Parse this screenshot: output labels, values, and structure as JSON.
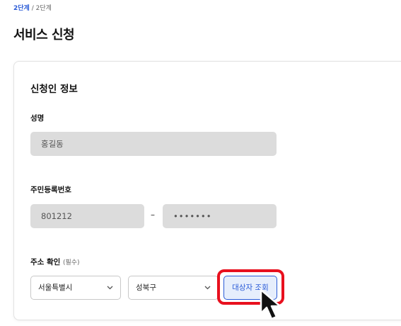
{
  "breadcrumb": {
    "current": "2단계",
    "separator": "/",
    "total": "2단계"
  },
  "page_title": "서비스 신청",
  "section": {
    "title": "신청인 정보",
    "name": {
      "label": "성명",
      "value": "홍길동"
    },
    "resident_number": {
      "label": "주민등록번호",
      "front": "801212",
      "separator": "–",
      "back": "•••••••"
    },
    "address": {
      "label": "주소 확인",
      "hint": "(필수)",
      "city": "서울특별시",
      "district": "성북구",
      "lookup_button": "대상자 조회"
    }
  },
  "colors": {
    "accent": "#2a5bd7",
    "highlight": "#e8101e",
    "field_bg": "#dcdcdc"
  },
  "icons": {
    "select_arrow": "chevron-down-icon",
    "cursor": "mouse-pointer-icon"
  }
}
